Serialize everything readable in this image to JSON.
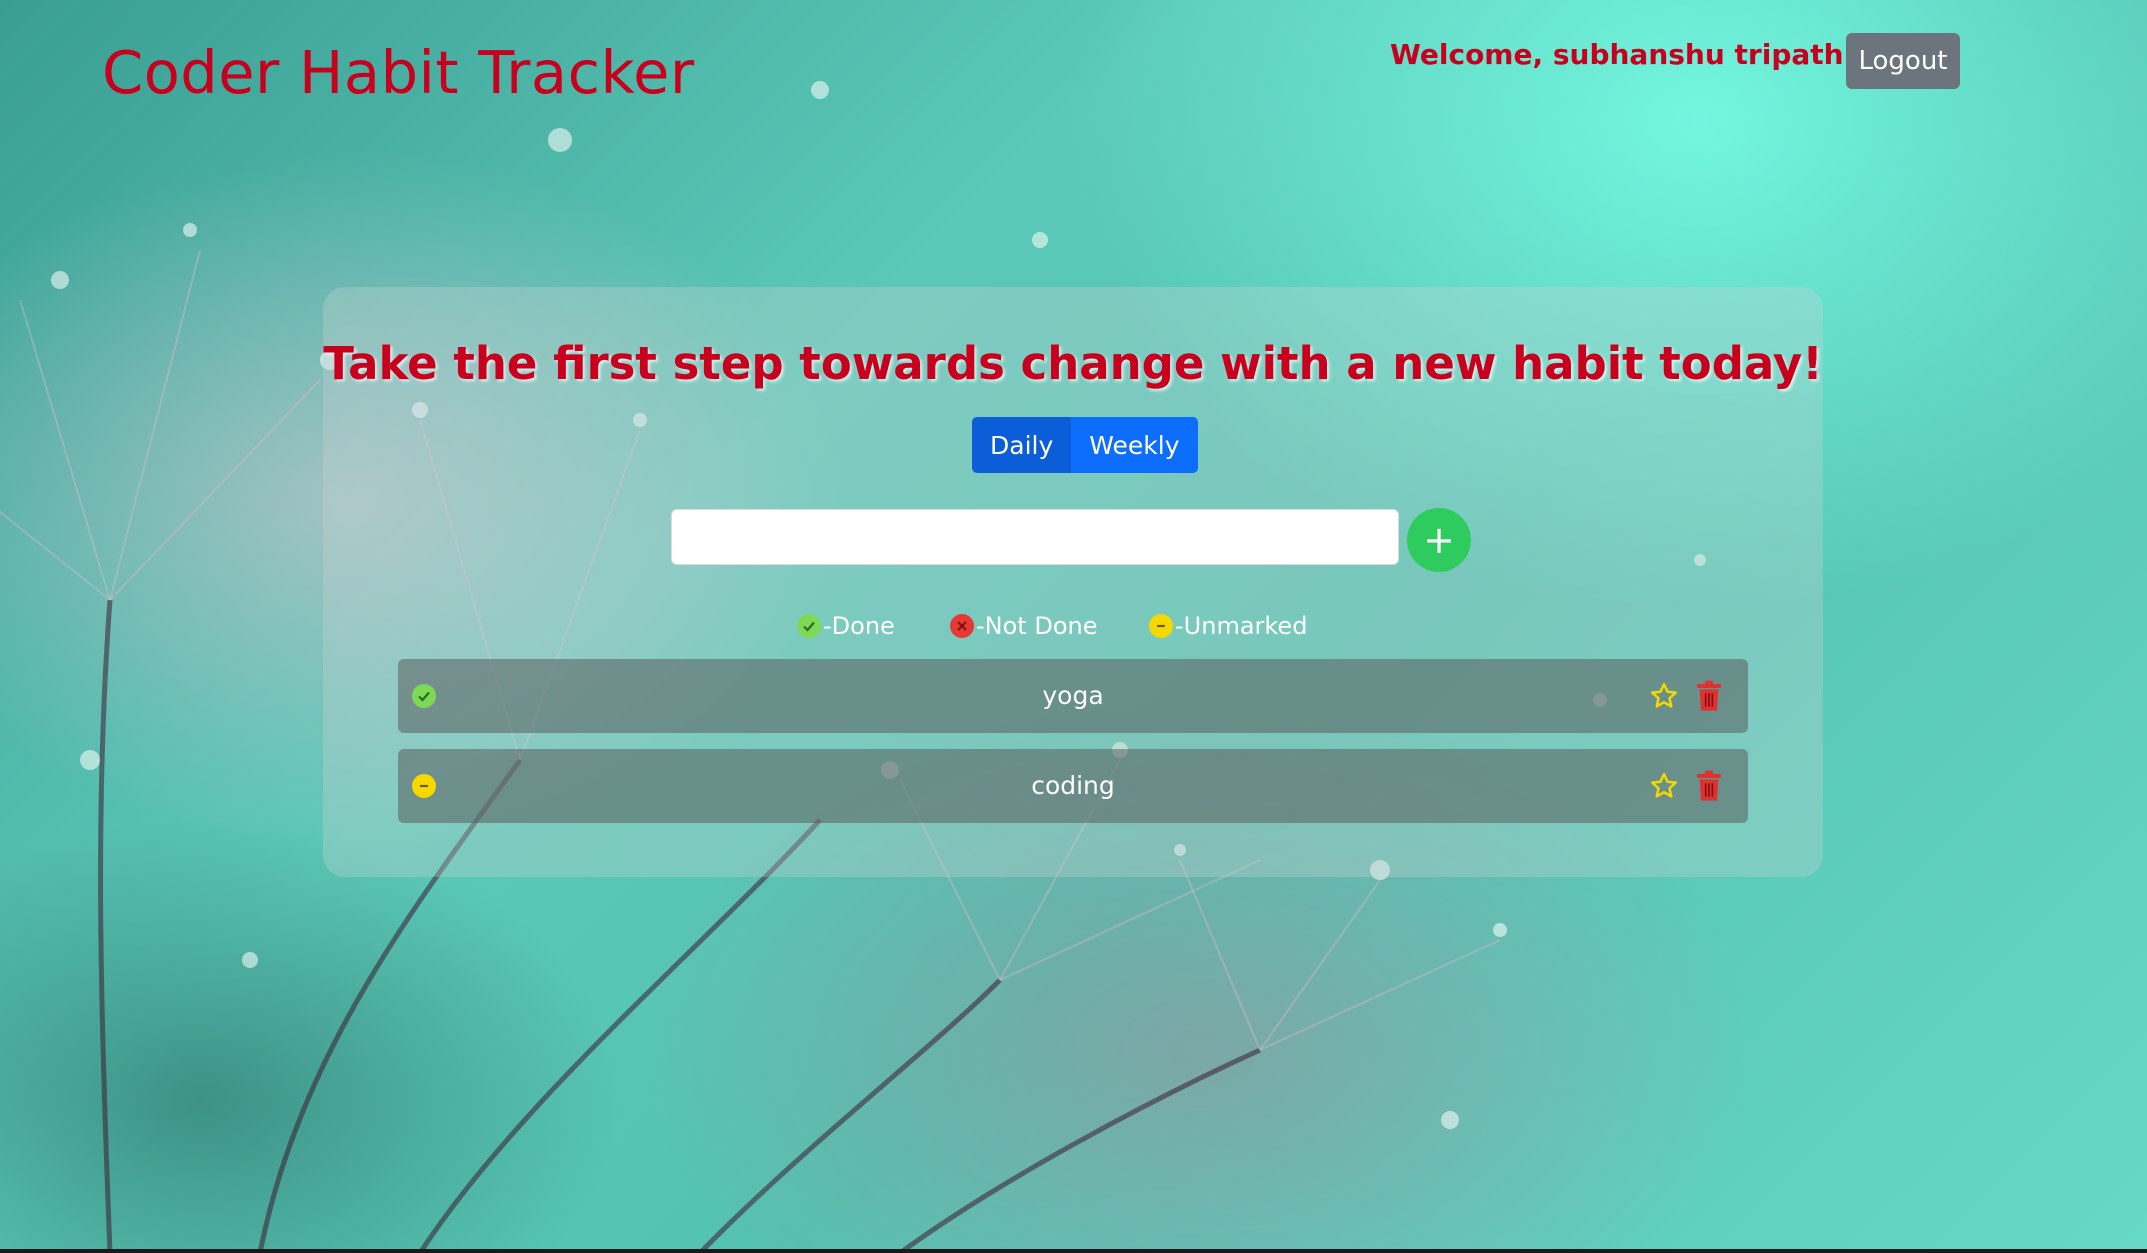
{
  "header": {
    "brand": "Coder Habit Tracker",
    "welcome": "Welcome, subhanshu tripathi",
    "logout_label": "Logout"
  },
  "main": {
    "headline": "Take the first step towards change with a new habit today!",
    "tabs": [
      {
        "label": "Daily",
        "active": true
      },
      {
        "label": "Weekly",
        "active": false
      }
    ],
    "habit_input": {
      "value": "",
      "placeholder": ""
    },
    "add_label": "+",
    "legend": [
      {
        "label": "-Done",
        "status": "done"
      },
      {
        "label": "-Not Done",
        "status": "not-done"
      },
      {
        "label": "-Unmarked",
        "status": "unmarked"
      }
    ],
    "habits": [
      {
        "name": "yoga",
        "status": "done"
      },
      {
        "name": "coding",
        "status": "unmarked"
      }
    ]
  },
  "colors": {
    "accent_red": "#c8001e",
    "done": "#7ed957",
    "not_done": "#e53935",
    "unmarked": "#f5d800",
    "add_button": "#2ecc5f",
    "primary_button": "#0d6efd",
    "logout_button": "#6c757d"
  },
  "icons": {
    "done": "check-circle-icon",
    "not_done": "x-circle-icon",
    "unmarked": "dash-circle-icon",
    "favorite": "star-icon",
    "delete": "trash-icon",
    "add": "plus-icon"
  }
}
